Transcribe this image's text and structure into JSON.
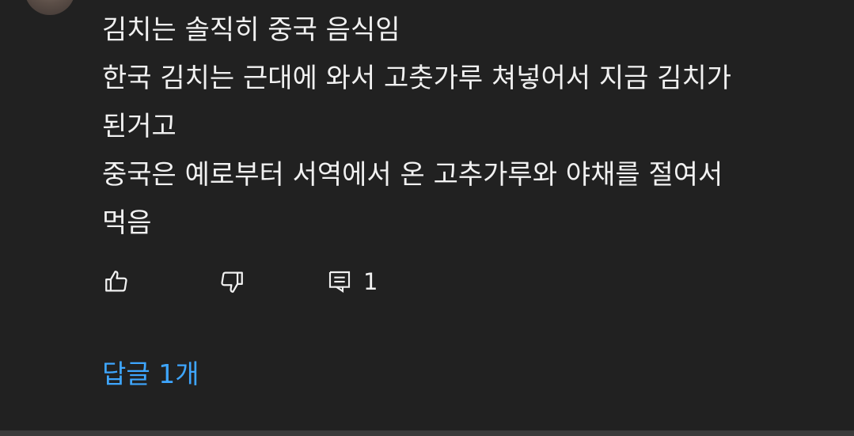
{
  "comment": {
    "lines": [
      "김치는 솔직히 중국 음식임",
      "한국 김치는 근대에 와서 고춧가루 쳐넣어서 지금 김치가",
      "된거고",
      "중국은 예로부터 서역에서 온 고추가루와 야채를 절여서",
      "먹음"
    ]
  },
  "actions": {
    "like_icon": "thumbs-up-icon",
    "dislike_icon": "thumbs-down-icon",
    "reply_icon": "comment-icon",
    "reply_count": "1"
  },
  "replies": {
    "label": "답글 1개"
  },
  "colors": {
    "background": "#212121",
    "text": "#f1f1f1",
    "link": "#3ea6ff"
  }
}
